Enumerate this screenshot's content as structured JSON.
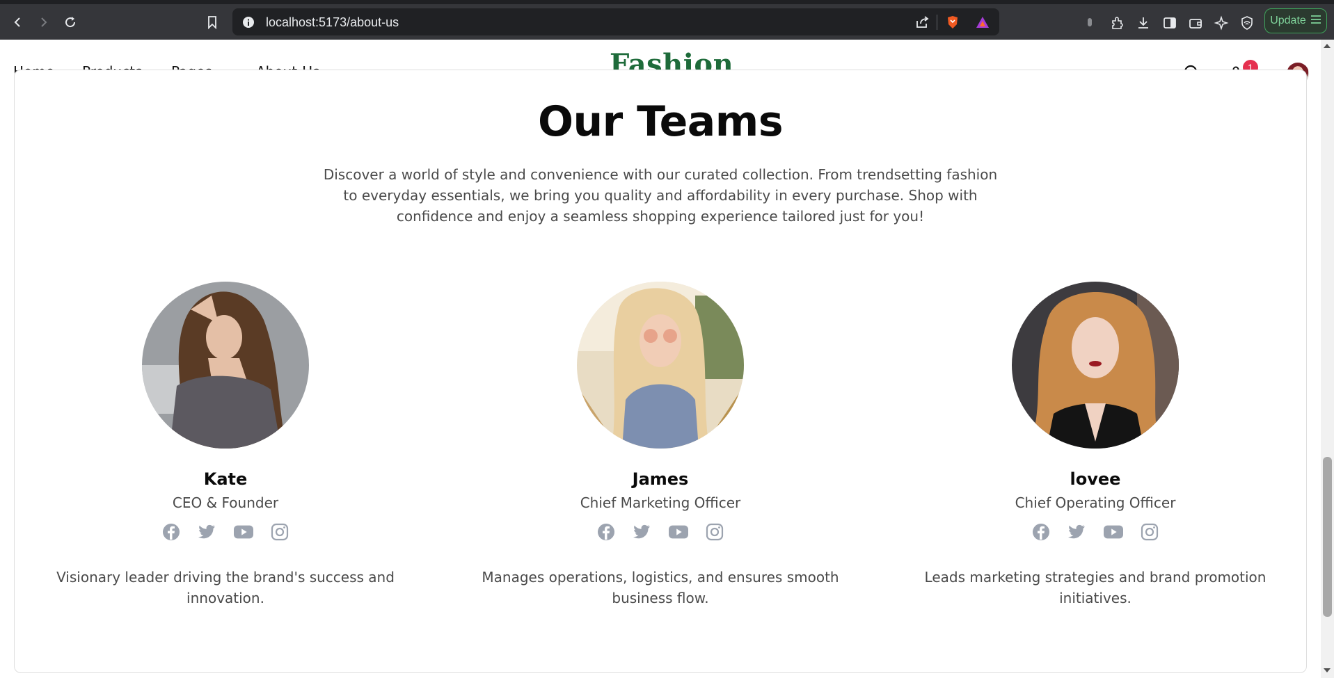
{
  "browser": {
    "url": "localhost:5173/about-us",
    "update_label": "Update"
  },
  "header": {
    "nav": [
      {
        "label": "Home"
      },
      {
        "label": "Products"
      },
      {
        "label": "Pages"
      },
      {
        "label": "About-Us"
      }
    ],
    "logo": "Fashion",
    "cart_count": "1"
  },
  "section": {
    "title": "Our Teams",
    "description": "Discover a world of style and convenience with our curated collection. From trendsetting fashion to everyday essentials, we bring you quality and affordability in every purchase. Shop with confidence and enjoy a seamless shopping experience tailored just for you!"
  },
  "team": [
    {
      "name": "Kate",
      "role": "CEO & Founder",
      "bio": "Visionary leader driving the brand's success and innovation."
    },
    {
      "name": "James",
      "role": "Chief Marketing Officer",
      "bio": "Manages operations, logistics, and ensures smooth business flow."
    },
    {
      "name": "lovee",
      "role": "Chief Operating Officer",
      "bio": "Leads marketing strategies and brand promotion initiatives."
    }
  ],
  "icons": [
    "back-icon",
    "forward-icon",
    "reload-icon",
    "bookmark-icon",
    "info-icon",
    "share-icon",
    "brave-shield-icon",
    "brave-rewards-icon",
    "extensions-icon",
    "download-icon",
    "sidebar-icon",
    "wallet-icon",
    "leo-icon",
    "vpn-icon",
    "search-icon",
    "cart-icon",
    "facebook-icon",
    "twitter-icon",
    "youtube-icon",
    "instagram-icon"
  ],
  "colors": {
    "brand": "#1e6b3a",
    "badge": "#e5304f",
    "social": "#9ca3af"
  }
}
